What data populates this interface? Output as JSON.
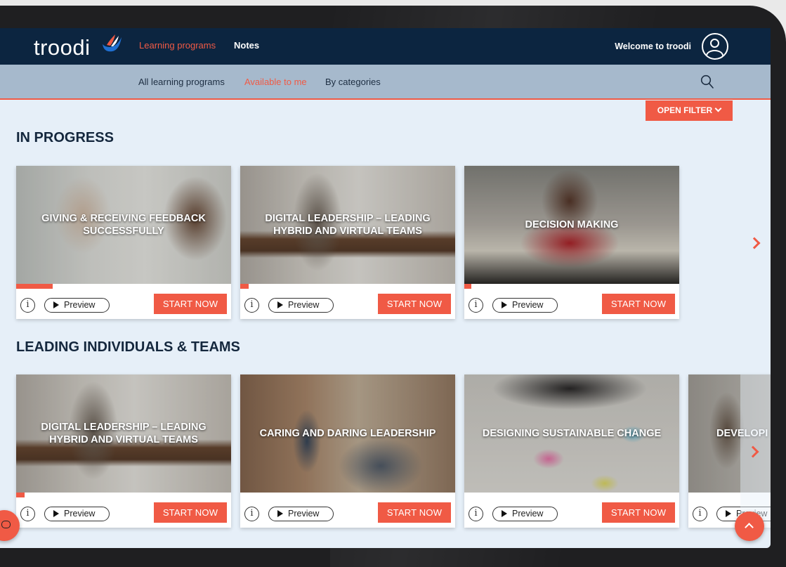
{
  "header": {
    "logo": "troodi",
    "nav": [
      "Learning programs",
      "Notes"
    ],
    "welcome": "Welcome to troodi"
  },
  "subnav": {
    "items": [
      "All learning programs",
      "Available to me",
      "By categories"
    ],
    "active": "Available to me"
  },
  "filter_button": "OPEN FILTER",
  "labels": {
    "preview": "Preview",
    "start": "START NOW",
    "info": "i"
  },
  "sections": [
    {
      "title": "IN PROGRESS",
      "cards": [
        {
          "title": "GIVING & RECEIVING FEEDBACK SUCCESSFULLY",
          "progress_pct": 17
        },
        {
          "title": "DIGITAL LEADERSHIP – LEADING HYBRID AND VIRTUAL TEAMS",
          "progress_pct": 4
        },
        {
          "title": "DECISION MAKING",
          "progress_pct": 3
        }
      ]
    },
    {
      "title": "LEADING INDIVIDUALS & TEAMS",
      "cards": [
        {
          "title": "DIGITAL LEADERSHIP – LEADING HYBRID AND VIRTUAL TEAMS",
          "progress_pct": 4
        },
        {
          "title": "CARING AND DARING LEADERSHIP"
        },
        {
          "title": "DESIGNING SUSTAINABLE CHANGE"
        },
        {
          "title": "DEVELOPI"
        }
      ]
    }
  ],
  "colors": {
    "accent": "#f05a45",
    "navy": "#0c2540",
    "subnav": "#a6b9cc",
    "page": "#e6eff8"
  },
  "icons": [
    "user-icon",
    "search-icon",
    "chevron-down-icon",
    "info-icon",
    "play-icon",
    "chevron-right-icon",
    "chevron-up-icon",
    "chat-icon"
  ]
}
